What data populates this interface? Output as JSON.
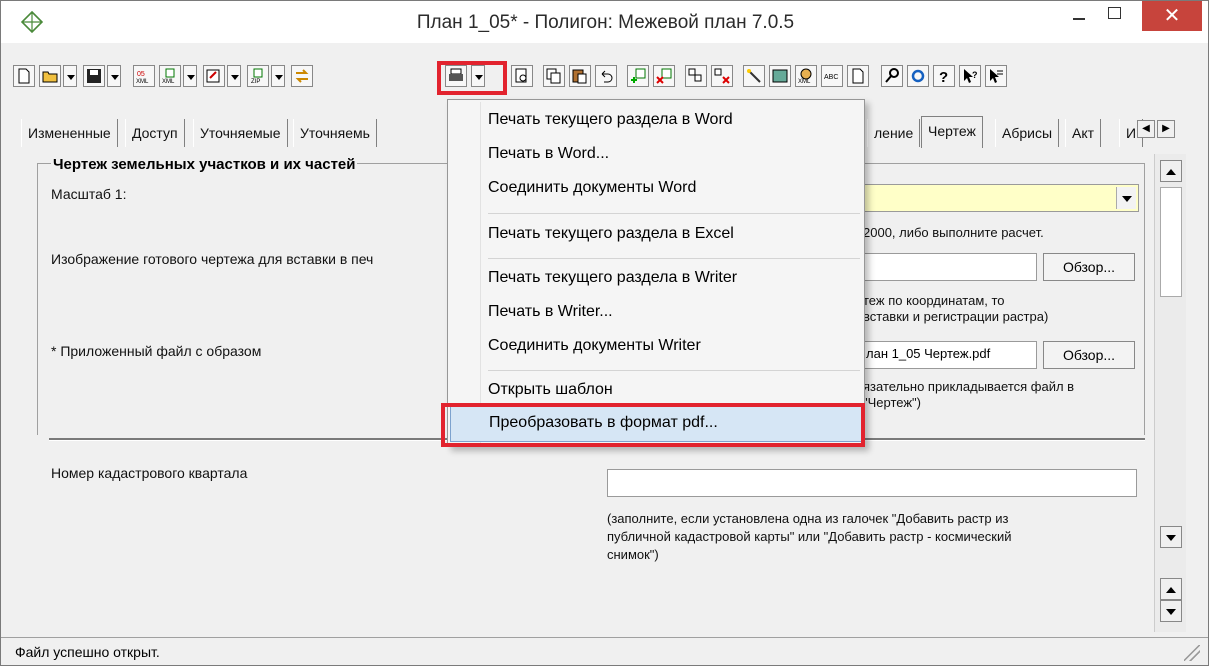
{
  "window": {
    "title": "План 1_05* - Полигон: Межевой план 7.0.5",
    "close_glyph": "✕"
  },
  "tabs": [
    {
      "label": "Измененные"
    },
    {
      "label": "Доступ"
    },
    {
      "label": "Уточняемые"
    },
    {
      "label": "Уточняемь"
    },
    {
      "label": "ление"
    },
    {
      "label": "Чертеж"
    },
    {
      "label": "Абрисы"
    },
    {
      "label": "Акт"
    },
    {
      "label": "И"
    }
  ],
  "group": {
    "title": "Чертеж земельных участков и их частей"
  },
  "form": {
    "scale_label": "Масштаб 1:",
    "scale_hint": "2000, либо выполните расчет.",
    "image_label": "Изображение готового чертежа для вставки в печ",
    "browse1": "Обзор...",
    "image_hint_1": "теж по координатам, то",
    "image_hint_2": "вставки и регистрации растра)",
    "file_label": "* Приложенный файл с образом",
    "file_value": "лан 1_05 Чертеж.pdf",
    "browse2": "Обзор...",
    "file_hint_1": "язательно прикладывается файл в",
    "file_hint_2": "\"Чертеж\")",
    "cadastral_label": "Номер кадастрового квартала",
    "cadastral_value": "",
    "cadastral_hint_1": "(заполните, если установлена одна из галочек \"Добавить растр из",
    "cadastral_hint_2": "публичной кадастровой карты\" или \"Добавить растр - космический",
    "cadastral_hint_3": "снимок\")"
  },
  "menu": {
    "items": [
      {
        "label": "Печать текущего раздела в Word"
      },
      {
        "label": "Печать в Word..."
      },
      {
        "label": "Соединить документы Word"
      },
      {
        "label": "Печать текущего раздела в Excel"
      },
      {
        "label": "Печать текущего раздела в Writer"
      },
      {
        "label": "Печать в Writer..."
      },
      {
        "label": "Соединить документы Writer"
      },
      {
        "label": "Открыть шаблон"
      },
      {
        "label": "Преобразовать в формат pdf..."
      }
    ]
  },
  "status": {
    "text": "Файл успешно открыт."
  },
  "colors": {
    "highlight": "#e2232e",
    "close": "#c7443c",
    "menu_hover": "#d6e6f5",
    "field_yellow": "#ffffc8"
  }
}
